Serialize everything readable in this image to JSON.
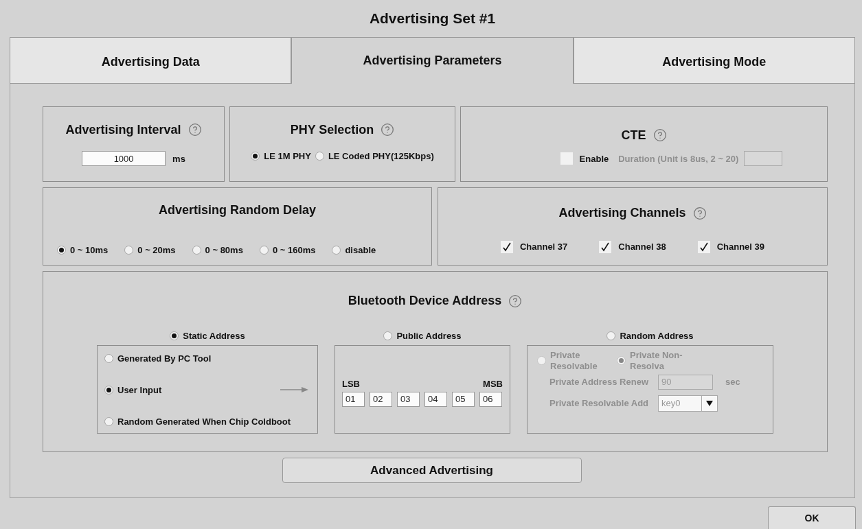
{
  "window": {
    "title": "Advertising Set #1"
  },
  "tabs": [
    {
      "label": "Advertising Data",
      "selected": false
    },
    {
      "label": "Advertising Parameters",
      "selected": true
    },
    {
      "label": "Advertising Mode",
      "selected": false
    }
  ],
  "advertising_interval": {
    "title": "Advertising Interval",
    "value": "1000",
    "unit": "ms"
  },
  "phy_selection": {
    "title": "PHY Selection",
    "options": [
      {
        "label": "LE 1M PHY",
        "selected": true
      },
      {
        "label": "LE Coded PHY(125Kbps)",
        "selected": false
      }
    ]
  },
  "cte": {
    "title": "CTE",
    "enable": {
      "label": "Enable",
      "checked": false
    },
    "duration": {
      "label": "Duration (Unit is 8us, 2 ~ 20)",
      "disabled": true
    }
  },
  "random_delay": {
    "title": "Advertising Random Delay",
    "options": [
      {
        "label": "0 ~ 10ms",
        "selected": true
      },
      {
        "label": "0 ~ 20ms",
        "selected": false
      },
      {
        "label": "0 ~ 80ms",
        "selected": false
      },
      {
        "label": "0 ~ 160ms",
        "selected": false
      },
      {
        "label": "disable",
        "selected": false
      }
    ]
  },
  "channels": {
    "title": "Advertising Channels",
    "items": [
      {
        "label": "Channel 37",
        "checked": true
      },
      {
        "label": "Channel 38",
        "checked": true
      },
      {
        "label": "Channel 39",
        "checked": true
      }
    ]
  },
  "device_address": {
    "title": "Bluetooth Device Address",
    "groups": [
      {
        "kind": "static",
        "label": "Static Address",
        "selected": true,
        "options": [
          {
            "label": "Generated By PC Tool",
            "selected": false
          },
          {
            "label": "User Input",
            "selected": true
          },
          {
            "label": "Random Generated When Chip Coldboot",
            "selected": false
          }
        ]
      },
      {
        "kind": "public",
        "label": "Public Address",
        "selected": false,
        "lsb": "LSB",
        "msb": "MSB",
        "bytes": [
          "01",
          "02",
          "03",
          "04",
          "05",
          "06"
        ]
      },
      {
        "kind": "random",
        "label": "Random Address",
        "selected": false,
        "disabled": true,
        "options": [
          {
            "label": "Private Resolvable",
            "selected": false
          },
          {
            "label": "Private Non-Resolva",
            "selected": true
          }
        ],
        "renew_label": "Private Address Renew",
        "renew_value": "90",
        "renew_unit": "sec",
        "key_label": "Private Resolvable Add",
        "key_value": "key0"
      }
    ]
  },
  "advanced_button": "Advanced Advertising",
  "ok_button": "OK"
}
